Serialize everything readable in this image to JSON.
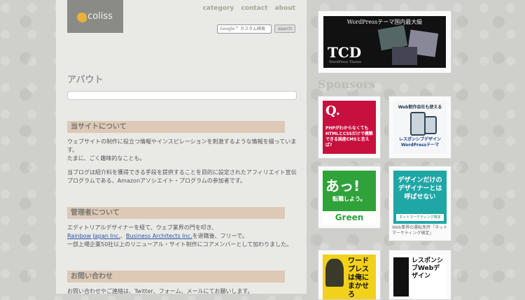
{
  "header": {
    "logo_text": "coliss",
    "nav": [
      "category",
      "contact",
      "about"
    ],
    "search_placeholder": "Google™ カスタム検索",
    "search_button": "search"
  },
  "page": {
    "title": "アバウト"
  },
  "sections": [
    {
      "heading": "当サイトについて",
      "paragraphs": [
        "ウェブサイトの制作に役立つ情報やインスピレーションを刺激するような情報を綴っています。",
        "たまに、ごく趣味的なことも。",
        "当ブログは紹介料を獲得できる手段を提供することを目的に設定されたアフィリエイト宣伝プログラムである、Amazonアソシエイト・プログラムの参加者です。"
      ]
    },
    {
      "heading": "管理者について",
      "line1": "エディトリアルデザイナーを経て、ウェブ業界の門を叩き、",
      "link1": "Rainbow Japan Inc.",
      "sep": "、",
      "link2": "Business Architects Inc.",
      "line2_tail": "を退職後、フリーで。",
      "line3": "一部上場企業50社以上のリニューアル・サイト制作にコアメンバーとして加わりました。"
    },
    {
      "heading": "お問い合わせ",
      "paragraph": "お問い合わせやご連絡は、Twitter、フォーム、メールにてお願いします。"
    }
  ],
  "sidebar": {
    "top_ad": {
      "title": "WordPressテーマ国内最大級",
      "logo": "TCD",
      "sub": "WordPress Theme"
    },
    "sponsors_heading": "Sponsors",
    "ads": [
      {
        "badge": "Q.",
        "text": "PHPがわからなくてもHTMLとCSSだけで構築できる国産CMSと言えば?"
      },
      {
        "text_top": "Web制作会社も使える",
        "text_bottom": "レスポンシブデザインWordPressテーマ"
      },
      {
        "big": "あっ!",
        "small": "転職しよう。",
        "brand": "Green"
      },
      {
        "text": "デザインだけのデザイナーとは呼ばせない",
        "badge": "ネットマーケティング検定",
        "caption": "Web業界の運転免許「ネットマーケティング検定」"
      },
      {
        "text": "ワードプレスは俺にまかせろ"
      },
      {
        "text": "レスポンシブWebデザイン"
      }
    ]
  },
  "colors": {
    "section_bg": "#ddc9b5",
    "link": "#2a55a8",
    "nav": "#a9a79b"
  }
}
